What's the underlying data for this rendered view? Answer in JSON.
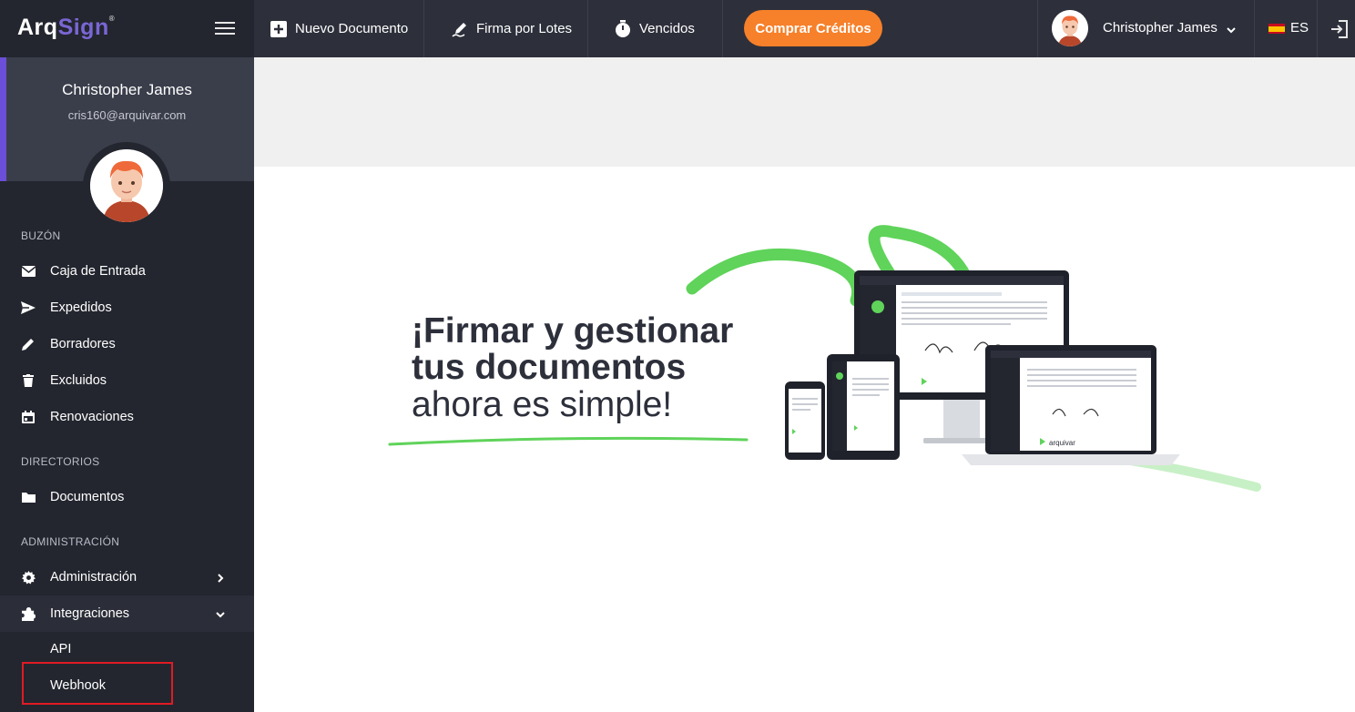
{
  "app": {
    "logo_part1": "Arq",
    "logo_part2": "Sign",
    "logo_mark": "®"
  },
  "sidebar": {
    "user_name": "Christopher James",
    "user_email": "cris160@arquivar.com",
    "sections": {
      "buzon": "BUZÓN",
      "directorios": "DIRECTORIOS",
      "administracion": "ADMINISTRACIÓN"
    },
    "items": {
      "inbox": "Caja de Entrada",
      "sent": "Expedidos",
      "drafts": "Borradores",
      "excluded": "Excluidos",
      "renewals": "Renovaciones",
      "documents": "Documentos",
      "administration": "Administración",
      "integrations": "Integraciones",
      "api": "API",
      "webhook": "Webhook"
    }
  },
  "topbar": {
    "new_document": "Nuevo Documento",
    "batch_sign": "Firma por Lotes",
    "expired": "Vencidos",
    "buy_credits": "Comprar Créditos",
    "user_name": "Christopher James",
    "language": "ES"
  },
  "hero": {
    "line1": "¡Firmar y gestionar",
    "line2": "tus documentos",
    "line3": "ahora es simple!",
    "brand_on_screens": "arquivar"
  },
  "colors": {
    "sidebar_bg": "#23262f",
    "topbar_bg": "#2d303b",
    "accent_purple": "#6b4fd8",
    "accent_orange": "#f7802a",
    "accent_green": "#5fd35a",
    "highlight_red": "#e01b24"
  }
}
